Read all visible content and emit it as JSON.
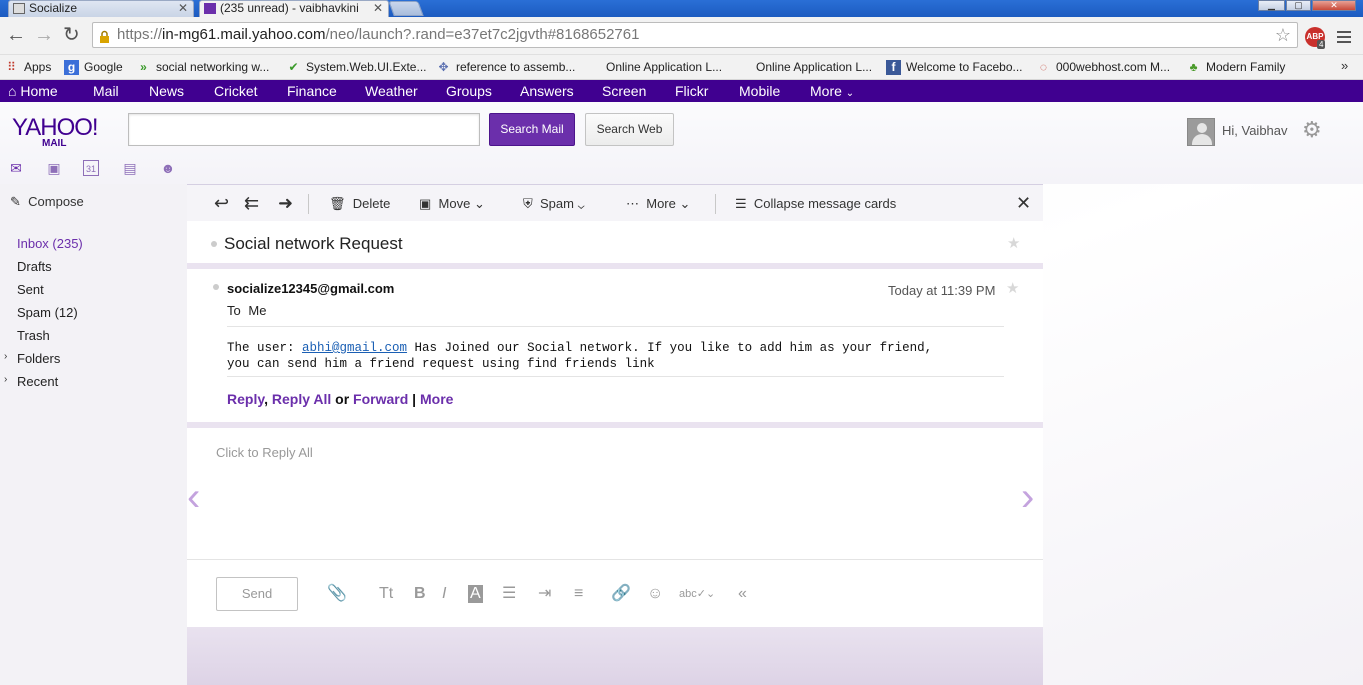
{
  "browser": {
    "tabs": [
      {
        "title": "Socialize",
        "active": false
      },
      {
        "title": "(235 unread) - vaibhavkini",
        "active": true
      }
    ],
    "url_scheme": "https://",
    "url_host": "in-mg61.mail.yahoo.com",
    "url_path": "/neo/launch?.rand=e37et7c2jgvth#8168652761",
    "abp_badge": "ABP",
    "abp_count": "4"
  },
  "bookmarks": [
    {
      "label": "Apps",
      "icon": "apps-grid-icon"
    },
    {
      "label": "Google",
      "icon": "google-icon"
    },
    {
      "label": "social networking w...",
      "icon": "chevrons-icon"
    },
    {
      "label": "System.Web.UI.Exte...",
      "icon": "check-icon"
    },
    {
      "label": "reference to assemb...",
      "icon": "bug-icon"
    },
    {
      "label": "Online Application L...",
      "icon": "page-icon"
    },
    {
      "label": "Online Application L...",
      "icon": "page-icon"
    },
    {
      "label": "Welcome to Facebo...",
      "icon": "facebook-icon"
    },
    {
      "label": "000webhost.com M...",
      "icon": "host-icon"
    },
    {
      "label": "Modern Family",
      "icon": "leaf-icon"
    }
  ],
  "yahoo_nav": [
    "Home",
    "Mail",
    "News",
    "Cricket",
    "Finance",
    "Weather",
    "Groups",
    "Answers",
    "Screen",
    "Flickr",
    "Mobile",
    "More"
  ],
  "header": {
    "logo": "YAHOO!",
    "logo_sub": "MAIL",
    "search_placeholder": "",
    "search_mail_label": "Search Mail",
    "search_web_label": "Search Web",
    "greeting": "Hi, Vaibhav"
  },
  "sidebar": {
    "compose_label": "Compose",
    "folders": [
      {
        "label": "Inbox (235)",
        "active": true
      },
      {
        "label": "Drafts"
      },
      {
        "label": "Sent"
      },
      {
        "label": "Spam (12)"
      },
      {
        "label": "Trash"
      },
      {
        "label": "Folders",
        "expandable": true
      },
      {
        "label": "Recent",
        "expandable": true
      }
    ]
  },
  "toolbar": {
    "delete_label": "Delete",
    "move_label": "Move",
    "spam_label": "Spam",
    "more_label": "More",
    "collapse_label": "Collapse message cards"
  },
  "message": {
    "subject": "Social network Request",
    "sender": "socialize12345@gmail.com",
    "time": "Today at 11:39 PM",
    "to_label": "To",
    "to_value": "Me",
    "body_prefix": "The user: ",
    "body_link": "abhi@gmail.com",
    "body_line1_rest": " Has Joined our Social network. If you like to add him as your friend,",
    "body_line2": "you can send him a friend request using find friends link",
    "actions": {
      "reply": "Reply",
      "reply_all": "Reply All",
      "or": "or",
      "forward": "Forward",
      "sep": "|",
      "more": "More"
    }
  },
  "reply": {
    "placeholder": "Click to Reply All",
    "send_label": "Send"
  }
}
